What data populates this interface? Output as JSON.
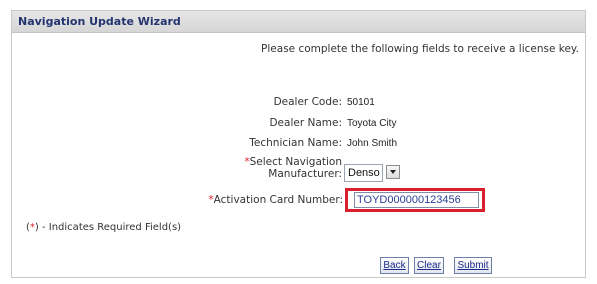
{
  "window": {
    "title": "Navigation Update Wizard"
  },
  "form": {
    "intro": "Please complete the following fields to receive a license key.",
    "dealer_code_label": "Dealer Code:",
    "dealer_code_value": "50101",
    "dealer_name_label": "Dealer Name:",
    "dealer_name_value": "Toyota City",
    "technician_label": "Technician Name:",
    "technician_value": "John Smith",
    "manufacturer_label_line1": "Select Navigation",
    "manufacturer_label_line2": "Manufacturer:",
    "manufacturer_selected": "Denso",
    "activation_label": "Activation Card Number:",
    "activation_value": "TOYD000000123456",
    "required_mark": "*",
    "required_note_prefix": "(",
    "required_note_mark": "*",
    "required_note_suffix": ") - Indicates Required Field(s)"
  },
  "buttons": {
    "back": "Back",
    "clear": "Clear",
    "submit": "Submit"
  },
  "colors": {
    "title": "#23346f",
    "required": "#e0202a",
    "highlight": "#d8202e",
    "link_text": "#1a2b8a"
  },
  "icons": {
    "dropdown": "chevron-down-icon"
  }
}
